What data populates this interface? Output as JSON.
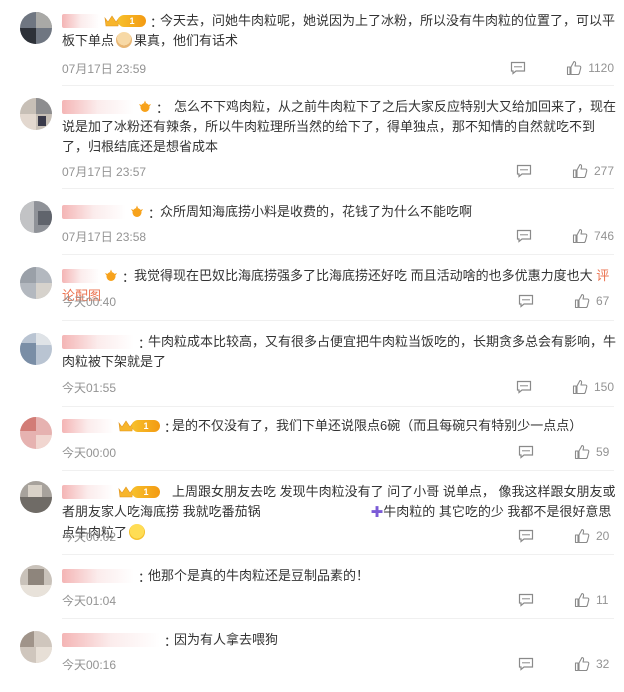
{
  "comments": [
    {
      "text": "今天去，问她牛肉粒呢，她说因为上了冰粉，所以没有牛肉粒的位置了，可以平板下单点",
      "text_after_emoji": "果真，他们有话术",
      "time": "07月17日 23:59",
      "likes": "1120",
      "badge": "crown",
      "level": "1"
    },
    {
      "text": "怎么不下鸡肉粒，从之前牛肉粒下了之后大家反应特别大又给加回来了，现在说是加了冰粉还有辣条，所以牛肉粒理所当然的给下了，得单独点，那不知情的自然就吃不到了，归根结底还是想省成本",
      "time": "07月17日 23:57",
      "likes": "277",
      "badge": "sun"
    },
    {
      "text": "众所周知海底捞小料是收费的，花钱了为什么不能吃啊",
      "time": "07月17日 23:58",
      "likes": "746",
      "badge": "sun"
    },
    {
      "text": "我觉得现在巴奴比海底捞强多了比海底捞还好吃 而且活动啥的也多优惠力度也大",
      "link": "评论配图",
      "time": "今天00:40",
      "likes": "67",
      "badge": "sun"
    },
    {
      "text": "牛肉粒成本比较高，又有很多占便宜把牛肉粒当饭吃的，长期贪多总会有影响，牛肉粒被下架就是了",
      "time": "今天01:55",
      "likes": "150",
      "badge": "none"
    },
    {
      "text": "是的不仅没有了，我们下单还说限点6碗（而且每碗只有特别少一点点）",
      "time": "今天00:00",
      "likes": "59",
      "badge": "crown",
      "level": "1"
    },
    {
      "text": "上周跟女朋友去吃 发现牛肉粒没有了 问了小哥 说单点， 像我这样跟女朋友或者朋友家人吃海底捞 我就吃番茄锅",
      "text_after_cross": "牛肉粒的 其它吃的少 我都不是很好意思点牛肉粒了",
      "time": "今天00:02",
      "likes": "20",
      "badge": "crown",
      "level": "1"
    },
    {
      "text": "他那个是真的牛肉粒还是豆制品素的！",
      "time": "今天01:04",
      "likes": "11",
      "badge": "none"
    },
    {
      "text": "因为有人拿去喂狗",
      "time": "今天00:16",
      "likes": "32",
      "badge": "none"
    }
  ],
  "icons": {
    "reply": "comment-bubble-icon",
    "like": "thumbs-up-icon",
    "crown": "crown-badge-icon",
    "sun": "sun-badge-icon"
  },
  "colors": {
    "time": "#939393",
    "link": "#eb7350",
    "badge": "#f39a12"
  }
}
